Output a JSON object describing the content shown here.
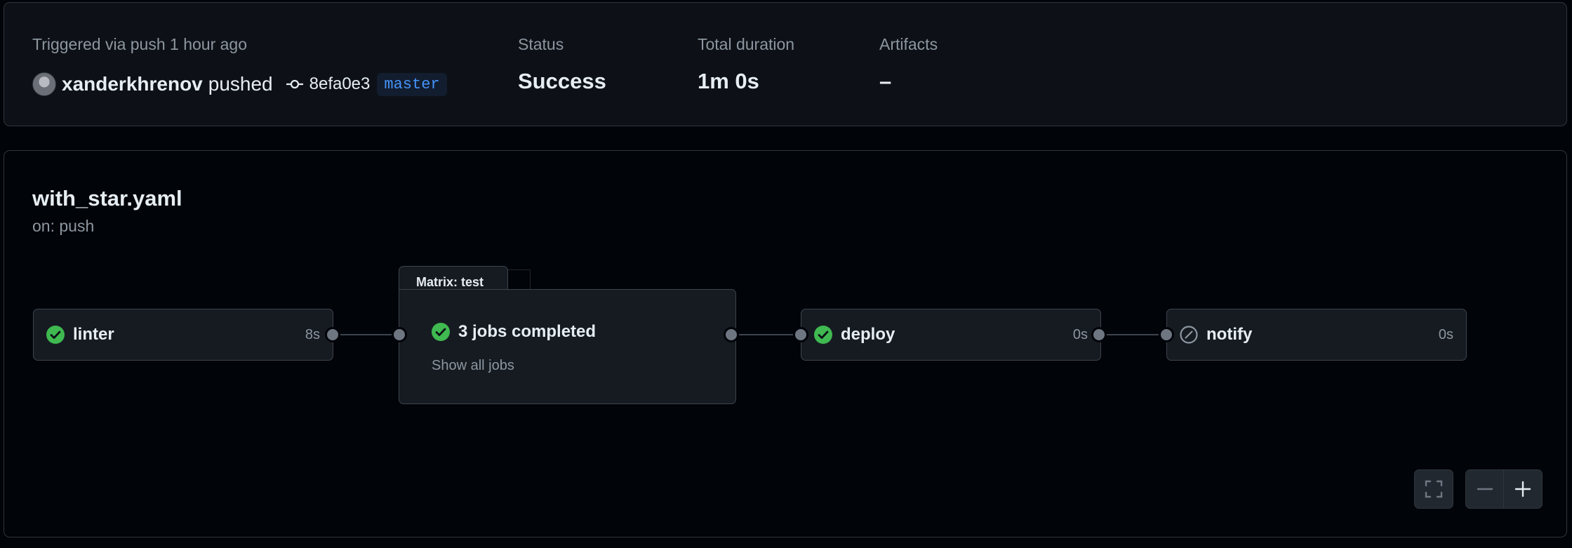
{
  "summary": {
    "trigger_text": "Triggered via push 1 hour ago",
    "actor": "xanderkhrenov",
    "action": "pushed",
    "commit_sha": "8efa0e3",
    "branch": "master",
    "status_label": "Status",
    "status_value": "Success",
    "duration_label": "Total duration",
    "duration_value": "1m 0s",
    "artifacts_label": "Artifacts",
    "artifacts_value": "–"
  },
  "workflow": {
    "file": "with_star.yaml",
    "trigger": "on: push"
  },
  "jobs": [
    {
      "name": "linter",
      "duration": "8s",
      "status": "success",
      "icon": "check-circle-icon"
    },
    {
      "name": "Matrix: test",
      "summary": "3 jobs completed",
      "link": "Show all jobs",
      "status": "success",
      "icon": "check-circle-icon"
    },
    {
      "name": "deploy",
      "duration": "0s",
      "status": "success",
      "icon": "check-circle-icon"
    },
    {
      "name": "notify",
      "duration": "0s",
      "status": "skipped",
      "icon": "skipped-icon"
    }
  ],
  "controls": {
    "fullscreen_icon": "fullscreen-icon",
    "zoom_out_icon": "minus-icon",
    "zoom_in_icon": "plus-icon"
  },
  "colors": {
    "success": "#3fb950",
    "link": "#4493f8",
    "background": "#010409",
    "panel": "#0d1117"
  }
}
